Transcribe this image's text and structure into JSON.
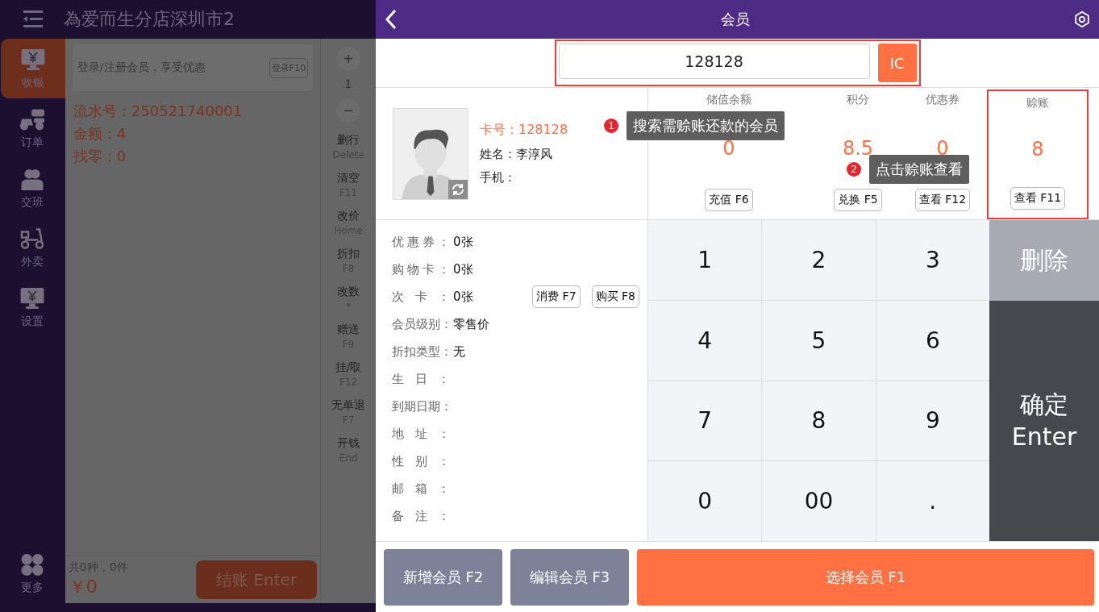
{
  "background_screen": {
    "store_title": "為爱而生分店深圳市2",
    "sidebar": [
      {
        "label": "收银",
        "kind": "cashier",
        "selected": true
      },
      {
        "label": "订单",
        "kind": "order",
        "selected": false
      },
      {
        "label": "交班",
        "kind": "shift",
        "selected": false
      },
      {
        "label": "外卖",
        "kind": "delivery",
        "selected": false
      },
      {
        "label": "设置",
        "kind": "cashier",
        "selected": false
      }
    ],
    "more": "更多",
    "login_banner": {
      "text": "登录/注册会员，享受优惠",
      "button": "登录F10"
    },
    "order_info": [
      "流水号：250521740001",
      "金额：4",
      "找零：0"
    ],
    "summary": "共0种，0件",
    "total": "￥0",
    "checkout": "结账 Enter",
    "quantity": {
      "plus": "+",
      "value": "1",
      "minus": "−"
    },
    "functions": [
      {
        "label": "删行",
        "key": "Delete"
      },
      {
        "label": "清空",
        "key": "F11"
      },
      {
        "label": "改价",
        "key": "Home"
      },
      {
        "label": "折扣",
        "key": "F8"
      },
      {
        "label": "改数",
        "key": "*"
      },
      {
        "label": "赠送",
        "key": "F9"
      },
      {
        "label": "挂/取",
        "key": "F12"
      },
      {
        "label": "无单退",
        "key": "F7"
      },
      {
        "label": "开钱",
        "key": "End"
      }
    ]
  },
  "dialog": {
    "title": "会员",
    "search": {
      "value": "128128",
      "ic_button": "IC",
      "highlighted": true
    },
    "member": {
      "card": "卡号：128128",
      "name": "姓名：李淳风",
      "phone": "手机："
    },
    "stats": [
      {
        "label": "储值余额",
        "value": "0",
        "button": "充值 F6",
        "highlighted": false
      },
      {
        "label": "积分",
        "value": "8.5",
        "button": "兑换 F5",
        "highlighted": false
      },
      {
        "label": "优惠券",
        "value": "0",
        "button": "查看 F12",
        "highlighted": false
      },
      {
        "label": "赊账",
        "value": "8",
        "button": "查看 F11",
        "highlighted": true
      }
    ],
    "details": [
      {
        "label": "优惠券：",
        "value": "0张"
      },
      {
        "label": "购物卡：",
        "value": "0张"
      },
      {
        "label": "次卡：",
        "value": "0张",
        "buttons": [
          "消费 F7",
          "购买 F8"
        ]
      },
      {
        "label": "会员级别：",
        "value": "零售价"
      },
      {
        "label": "折扣类型：",
        "value": "无"
      },
      {
        "label": "生日："
      },
      {
        "label": "到期日期："
      },
      {
        "label": "地址："
      },
      {
        "label": "性别："
      },
      {
        "label": "邮箱："
      },
      {
        "label": "备注："
      }
    ],
    "keypad": [
      "1",
      "2",
      "3",
      "4",
      "5",
      "6",
      "7",
      "8",
      "9",
      "0",
      "00",
      "."
    ],
    "delete_key": "删除",
    "confirm_key": [
      "确定",
      "Enter"
    ],
    "bottom_buttons": [
      {
        "label": "新增会员 F2",
        "kind": "secondary"
      },
      {
        "label": "编辑会员 F3",
        "kind": "secondary"
      },
      {
        "label": "选择会员 F1",
        "kind": "primary"
      }
    ],
    "annotations": [
      {
        "number": "1",
        "text": "搜索需赊账还款的会员"
      },
      {
        "number": "2",
        "text": "点击赊账查看"
      }
    ]
  }
}
